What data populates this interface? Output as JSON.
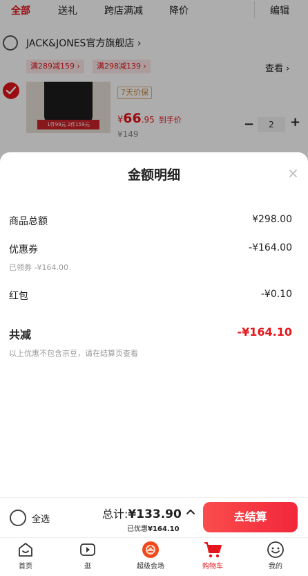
{
  "tabs": {
    "items": [
      "全部",
      "送礼",
      "跨店满减",
      "降价"
    ],
    "edit": "编辑"
  },
  "store": {
    "name": "JACK&JONES官方旗舰店 ›",
    "promos": [
      "满289减159 ›",
      "满298减139 ›"
    ],
    "view": "查看 ›"
  },
  "product": {
    "image_tag": "1件99元 2件159元",
    "guarantee": "7天价保",
    "price_symbol": "¥",
    "price_int": "66",
    "price_dec": ".95",
    "price_tag": "到手价",
    "orig_price": "¥149",
    "minus": "−",
    "quantity": "2",
    "plus": "+"
  },
  "sheet": {
    "title": "金额明细",
    "close": "×",
    "lines": {
      "goods_label": "商品总额",
      "goods_value": "¥298.00",
      "coupon_label": "优惠券",
      "coupon_value": "-¥164.00",
      "coupon_note": "已领券 -¥164.00",
      "redpacket_label": "红包",
      "redpacket_value": "-¥0.10",
      "total_label": "共减",
      "total_value": "-¥164.10",
      "footnote": "以上优惠不包含京豆，请在结算页查看"
    }
  },
  "checkout": {
    "select_all": "全选",
    "total_text": "总计:",
    "total_amount": "¥133.90",
    "discount_prefix": "已优惠",
    "discount_amount": "¥164.10",
    "button": "去结算"
  },
  "nav": {
    "items": [
      {
        "label": "首页",
        "icon": "home-icon"
      },
      {
        "label": "逛",
        "icon": "play-icon"
      },
      {
        "label": "超级会场",
        "icon": "venue-icon"
      },
      {
        "label": "购物车",
        "icon": "cart-icon"
      },
      {
        "label": "我的",
        "icon": "profile-icon"
      }
    ]
  },
  "colors": {
    "accent": "#e4161b",
    "promo_bg": "#fde8e8",
    "guarantee": "#c8883a",
    "button_start": "#fa4d4d",
    "button_end": "#f2273a"
  }
}
